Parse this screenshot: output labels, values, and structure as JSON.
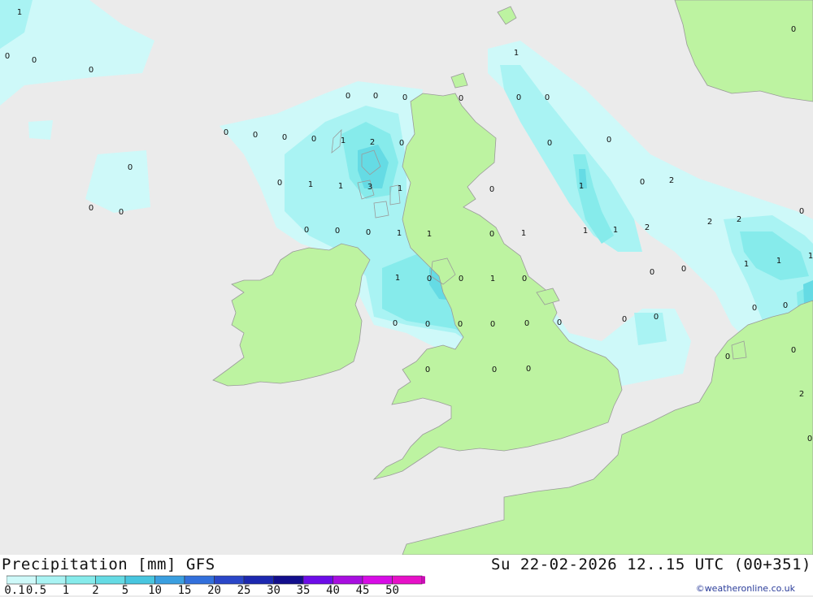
{
  "header": {
    "title_left": "Precipitation [mm] GFS",
    "title_right": "Su 22-02-2026 12..15 UTC (00+351)"
  },
  "scale": {
    "labels": [
      "0.1",
      "0.5",
      "1",
      "2",
      "5",
      "10",
      "15",
      "20",
      "25",
      "30",
      "35",
      "40",
      "45",
      "50"
    ],
    "colors": [
      "#cef9f9",
      "#a9f3f3",
      "#86ebeb",
      "#65dbe4",
      "#48c6df",
      "#3a9fe0",
      "#3270dc",
      "#2a46c8",
      "#1c28b0",
      "#120e8c",
      "#6d0ce8",
      "#a80ee0",
      "#d70ce6",
      "#e710c8",
      "#c810b4"
    ]
  },
  "credit": "©weatheronline.co.uk",
  "map": {
    "colors": {
      "sea": "#ebebeb",
      "land": "#bdf3a1",
      "coast": "#9a9a9a",
      "precip_light": "#cef9f9",
      "precip_1": "#a9f3f3",
      "precip_2": "#86ebeb",
      "precip_3": "#65dbe4"
    },
    "values": [
      "1",
      "0",
      "0",
      "0",
      "0",
      "0",
      "0",
      "0",
      "0",
      "0",
      "0",
      "0",
      "0",
      "0",
      "0",
      "1",
      "2",
      "0",
      "0",
      "1",
      "1",
      "3",
      "1",
      "0",
      "0",
      "0",
      "1",
      "1",
      "0",
      "0",
      "1",
      "1",
      "0",
      "0",
      "0",
      "0",
      "1",
      "0",
      "2",
      "1",
      "1",
      "2",
      "2",
      "2",
      "0",
      "0",
      "0",
      "1",
      "1",
      "1",
      "1",
      "0",
      "0",
      "1",
      "0",
      "0",
      "0",
      "0",
      "0",
      "0",
      "0",
      "0",
      "0",
      "0",
      "0",
      "0",
      "0",
      "0",
      "2",
      "0",
      "0",
      "0",
      "0"
    ]
  }
}
